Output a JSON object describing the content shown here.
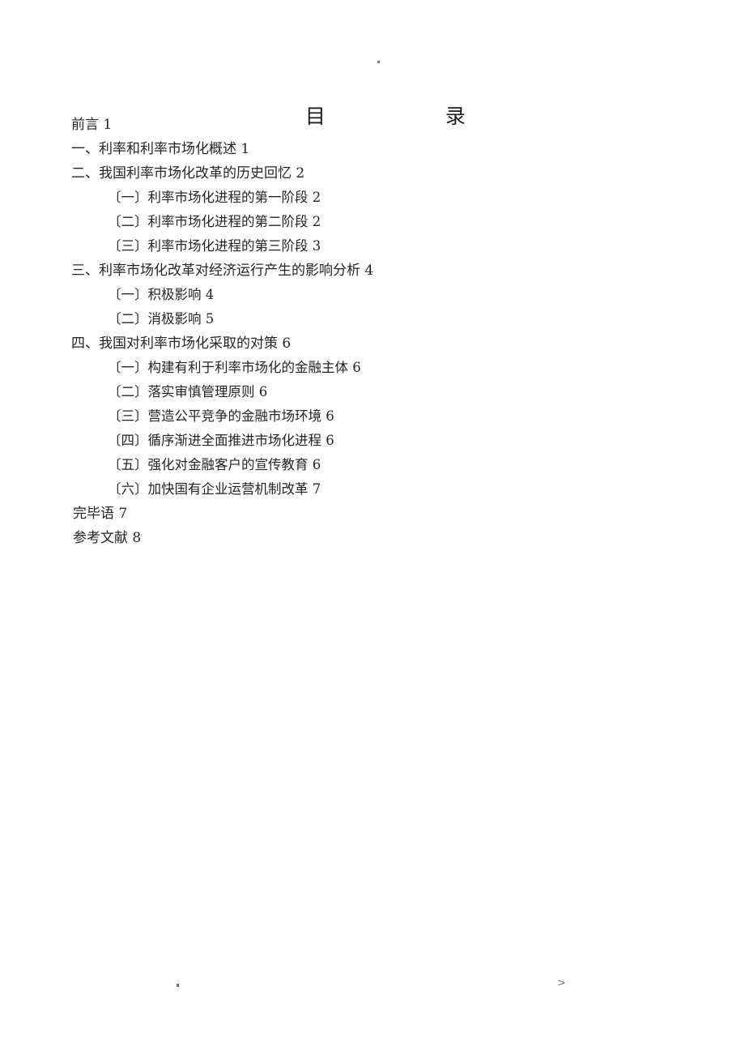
{
  "document": {
    "title_chars": [
      "目",
      "录"
    ],
    "title_text": "目        录"
  },
  "toc": {
    "entries": [
      {
        "level": "main",
        "title": "前言",
        "page": "1",
        "text": "前言 1"
      },
      {
        "level": "main",
        "title": "一、利率和利率市场化概述",
        "page": "1",
        "text": "一、利率和利率市场化概述 1"
      },
      {
        "level": "main",
        "title": "二、我国利率市场化改革的历史回忆",
        "page": "2",
        "text": "二、我国利率市场化改革的历史回忆 2"
      },
      {
        "level": "sub",
        "title": "〔一〕利率市场化进程的第一阶段",
        "page": "2",
        "text": "〔一〕利率市场化进程的第一阶段 2"
      },
      {
        "level": "sub",
        "title": "〔二〕利率市场化进程的第二阶段",
        "page": "2",
        "text": "〔二〕利率市场化进程的第二阶段 2"
      },
      {
        "level": "sub",
        "title": "〔三〕利率市场化进程的第三阶段",
        "page": "3",
        "text": "〔三〕利率市场化进程的第三阶段 3"
      },
      {
        "level": "main",
        "title": "三、利率市场化改革对经济运行产生的影响分析",
        "page": "4",
        "text": "三、利率市场化改革对经济运行产生的影响分析 4"
      },
      {
        "level": "sub",
        "title": "〔一〕积极影响",
        "page": "4",
        "text": "〔一〕积极影响 4"
      },
      {
        "level": "sub",
        "title": "〔二〕消极影响",
        "page": "5",
        "text": "〔二〕消极影响 5"
      },
      {
        "level": "main",
        "title": "四、我国对利率市场化采取的对策",
        "page": "6",
        "text": "四、我国对利率市场化采取的对策 6"
      },
      {
        "level": "sub",
        "title": "〔一〕构建有利于利率市场化的金融主体",
        "page": "6",
        "text": "〔一〕构建有利于利率市场化的金融主体 6"
      },
      {
        "level": "sub",
        "title": "〔二〕落实审慎管理原则",
        "page": "6",
        "text": "〔二〕落实审慎管理原则 6"
      },
      {
        "level": "sub",
        "title": "〔三〕营造公平竞争的金融市场环境",
        "page": "6",
        "text": "〔三〕营造公平竞争的金融市场环境 6"
      },
      {
        "level": "sub",
        "title": "〔四〕循序渐进全面推进市场化进程",
        "page": "6",
        "text": "〔四〕循序渐进全面推进市场化进程 6"
      },
      {
        "level": "sub",
        "title": "〔五〕强化对金融客户的宣传教育",
        "page": "6",
        "text": "〔五〕强化对金融客户的宣传教育 6"
      },
      {
        "level": "sub",
        "title": "〔六〕加快国有企业运营机制改革",
        "page": "7",
        "text": "〔六〕加快国有企业运营机制改革 7"
      },
      {
        "level": "tail",
        "title": "完毕语",
        "page": "7",
        "text": "完毕语 7"
      },
      {
        "level": "tail",
        "title": "参考文献",
        "page": "8",
        "text": "参考文献 8"
      }
    ]
  },
  "artifacts": {
    "bottom_right_glyph": ">"
  },
  "colors": {
    "page_background": "#ffffff",
    "body_text": "#262329",
    "title_text": "#1d1b21"
  }
}
